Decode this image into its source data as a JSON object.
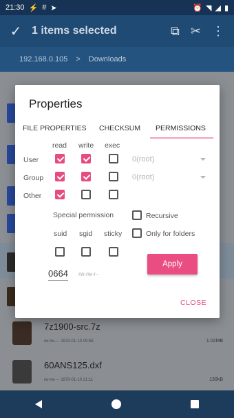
{
  "status": {
    "time": "21:30",
    "battery": ""
  },
  "toolbar": {
    "title": "1 items selected"
  },
  "path": {
    "host": "192.168.0.105",
    "separator": ">",
    "folder": "Downloads"
  },
  "rows": [
    {
      "name": "7z1900-src.7z",
      "meta": "rw-rw---- 1970-01-10 09:58",
      "size": "1.02MB"
    },
    {
      "name": "60ANS125.dxf",
      "meta": "rw-rw---- 1970-01-10 21:11",
      "size": "130kB"
    }
  ],
  "dialog": {
    "title": "Properties",
    "tabs": [
      "FILE PROPERTIES",
      "CHECKSUM",
      "PERMISSIONS"
    ],
    "cols": [
      "read",
      "write",
      "exec"
    ],
    "rows": [
      {
        "label": "User",
        "read": true,
        "write": true,
        "exec": false,
        "owner": "0(root)"
      },
      {
        "label": "Group",
        "read": true,
        "write": true,
        "exec": false,
        "owner": "0(root)"
      },
      {
        "label": "Other",
        "read": true,
        "write": false,
        "exec": false
      }
    ],
    "special_label": "Special permission",
    "special_cols": [
      "suid",
      "sgid",
      "sticky"
    ],
    "recursive_label": "Recursive",
    "folders_label": "Only for folders",
    "mode_value": "0664",
    "mode_string": "rw-rw-r--",
    "apply_label": "Apply",
    "close_label": "CLOSE"
  },
  "colors": {
    "accent": "#e64c82",
    "toolbar": "#1e4a73"
  }
}
